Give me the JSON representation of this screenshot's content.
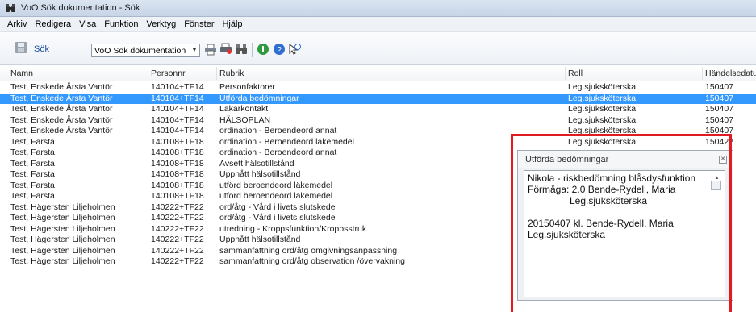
{
  "window": {
    "title": "VoO Sök dokumentation - Sök",
    "icon": "binoculars-icon"
  },
  "menu": [
    "Arkiv",
    "Redigera",
    "Visa",
    "Funktion",
    "Verktyg",
    "Fönster",
    "Hjälp"
  ],
  "toolbar": {
    "search_label": "Sök",
    "select_value": "VoO Sök dokumentation",
    "icons": [
      "save-icon",
      "print-icon",
      "print-all-icon",
      "binoculars-icon",
      "info-icon",
      "help-icon",
      "pointer-help-icon"
    ]
  },
  "columns": [
    "Namn",
    "Personnr",
    "Rubrik",
    "Roll",
    "Händelsedatum"
  ],
  "rows": [
    {
      "namn": "Test, Enskede Årsta Vantör",
      "pnr": "140104+TF14",
      "rubrik": "Personfaktorer",
      "roll": "Leg.sjuksköterska",
      "datum": "150407",
      "selected": false
    },
    {
      "namn": "Test, Enskede Årsta Vantör",
      "pnr": "140104+TF14",
      "rubrik": "Utförda bedömningar",
      "roll": "Leg.sjuksköterska",
      "datum": "150407",
      "selected": true
    },
    {
      "namn": "Test, Enskede Årsta Vantör",
      "pnr": "140104+TF14",
      "rubrik": "Läkarkontakt",
      "roll": "Leg.sjuksköterska",
      "datum": "150407",
      "selected": false
    },
    {
      "namn": "Test, Enskede Årsta Vantör",
      "pnr": "140104+TF14",
      "rubrik": "HÄLSOPLAN",
      "roll": "Leg.sjuksköterska",
      "datum": "150407",
      "selected": false
    },
    {
      "namn": "Test, Enskede Årsta Vantör",
      "pnr": "140104+TF14",
      "rubrik": "ordination - Beroendeord annat",
      "roll": "Leg.sjuksköterska",
      "datum": "150407",
      "selected": false
    },
    {
      "namn": "Test, Farsta",
      "pnr": "140108+TF18",
      "rubrik": "ordination - Beroendeord läkemedel",
      "roll": "Leg.sjuksköterska",
      "datum": "150422",
      "selected": false
    },
    {
      "namn": "Test, Farsta",
      "pnr": "140108+TF18",
      "rubrik": "ordination - Beroendeord annat",
      "roll": "",
      "datum": "",
      "selected": false
    },
    {
      "namn": "Test, Farsta",
      "pnr": "140108+TF18",
      "rubrik": "Avsett hälsotillstånd",
      "roll": "",
      "datum": "",
      "selected": false
    },
    {
      "namn": "Test, Farsta",
      "pnr": "140108+TF18",
      "rubrik": "Uppnått hälsotillstånd",
      "roll": "",
      "datum": "",
      "selected": false
    },
    {
      "namn": "Test, Farsta",
      "pnr": "140108+TF18",
      "rubrik": "utförd beroendeord läkemedel",
      "roll": "",
      "datum": "",
      "selected": false
    },
    {
      "namn": "Test, Farsta",
      "pnr": "140108+TF18",
      "rubrik": "utförd beroendeord läkemedel",
      "roll": "",
      "datum": "",
      "selected": false
    },
    {
      "namn": "Test, Hägersten Liljeholmen",
      "pnr": "140222+TF22",
      "rubrik": "ord/åtg - Vård i livets slutskede",
      "roll": "",
      "datum": "",
      "selected": false
    },
    {
      "namn": "Test, Hägersten Liljeholmen",
      "pnr": "140222+TF22",
      "rubrik": "ord/åtg - Vård i livets slutskede",
      "roll": "",
      "datum": "",
      "selected": false
    },
    {
      "namn": "Test, Hägersten Liljeholmen",
      "pnr": "140222+TF22",
      "rubrik": "utredning - Kroppsfunktion/Kroppsstruk",
      "roll": "",
      "datum": "",
      "selected": false
    },
    {
      "namn": "Test, Hägersten Liljeholmen",
      "pnr": "140222+TF22",
      "rubrik": "Uppnått hälsotillstånd",
      "roll": "",
      "datum": "",
      "selected": false
    },
    {
      "namn": "Test, Hägersten Liljeholmen",
      "pnr": "140222+TF22",
      "rubrik": "sammanfattning ord/åtg omgivningsanpassning",
      "roll": "",
      "datum": "",
      "selected": false
    },
    {
      "namn": "Test, Hägersten Liljeholmen",
      "pnr": "140222+TF22",
      "rubrik": "sammanfattning ord/åtg observation /övervakning",
      "roll": "",
      "datum": "",
      "selected": false
    }
  ],
  "popup": {
    "title": "Utförda bedömningar",
    "lines": [
      "Nikola - riskbedömning blåsdysfunktion",
      "Förmåga:  2.0 Bende-Rydell, Maria",
      "          Leg.sjuksköterska",
      "",
      "20150407 kl.  Bende-Rydell, Maria",
      "Leg.sjuksköterska"
    ]
  },
  "colors": {
    "selection": "#3399ff",
    "highlight_border": "#e11b22"
  }
}
